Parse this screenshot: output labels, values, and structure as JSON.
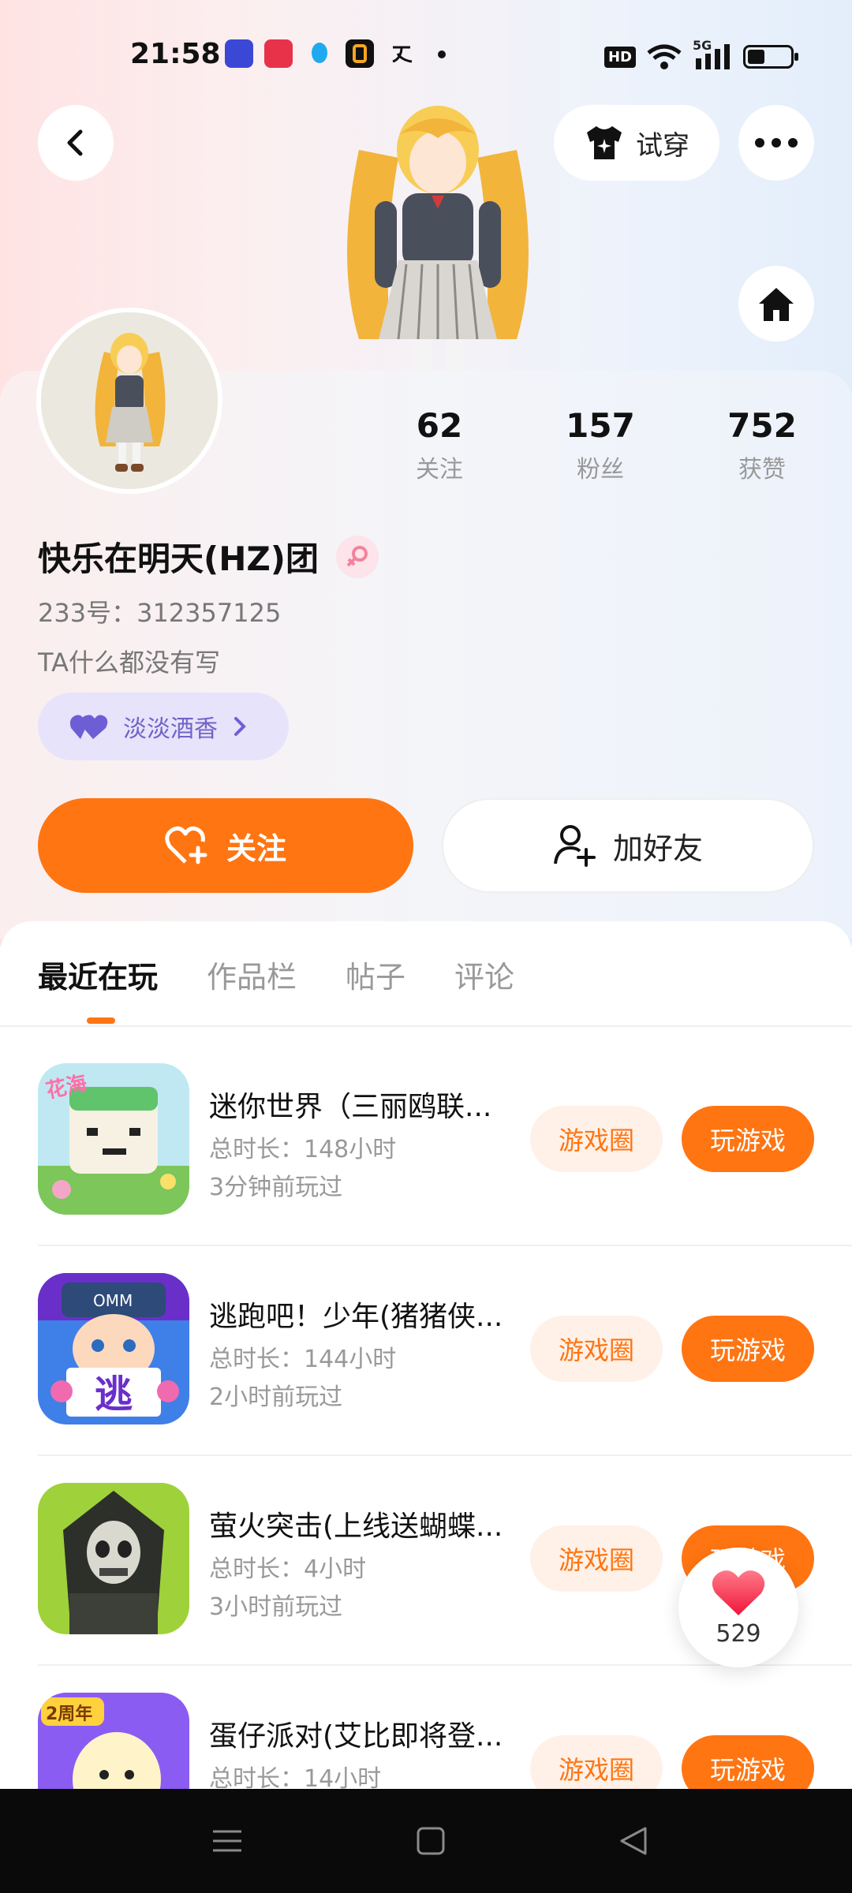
{
  "status_bar": {
    "time": "21:58",
    "hd_label": "HD",
    "network_label": "5G",
    "battery_percent": 40
  },
  "header": {
    "try_on_label": "试穿"
  },
  "profile": {
    "stats": [
      {
        "value": "62",
        "label": "关注"
      },
      {
        "value": "157",
        "label": "粉丝"
      },
      {
        "value": "752",
        "label": "获赞"
      }
    ],
    "username": "快乐在明天(HZ)团",
    "uid": "233号：312357125",
    "bio": "TA什么都没有写",
    "tag": "淡淡酒香",
    "follow_label": "关注",
    "add_friend_label": "加好友"
  },
  "tabs": [
    {
      "label": "最近在玩",
      "active": true
    },
    {
      "label": "作品栏",
      "active": false
    },
    {
      "label": "帖子",
      "active": false
    },
    {
      "label": "评论",
      "active": false
    }
  ],
  "games": [
    {
      "title": "迷你世界（三丽鸥联...",
      "duration": "总时长：148小时",
      "last_played": "3分钟前玩过",
      "circle_label": "游戏圈",
      "play_label": "玩游戏"
    },
    {
      "title": "逃跑吧！少年(猪猪侠...",
      "duration": "总时长：144小时",
      "last_played": "2小时前玩过",
      "circle_label": "游戏圈",
      "play_label": "玩游戏"
    },
    {
      "title": "萤火突击(上线送蝴蝶...",
      "duration": "总时长：4小时",
      "last_played": "3小时前玩过",
      "circle_label": "游戏圈",
      "play_label": "玩游戏"
    },
    {
      "title": "蛋仔派对(艾比即将登...",
      "duration": "总时长：14小时",
      "last_played": "",
      "circle_label": "游戏圈",
      "play_label": "玩游戏"
    }
  ],
  "icon_texts": {
    "game1_badge": "花海",
    "game2_sign": "逃",
    "game2_hat": "OMM",
    "game4_badge": "2周年"
  },
  "like_button": {
    "count": "529"
  },
  "colors": {
    "accent": "#ff7512",
    "accent_light": "#fff1e8",
    "tag_bg": "#e7e3fb",
    "tag_text": "#7063c8"
  }
}
